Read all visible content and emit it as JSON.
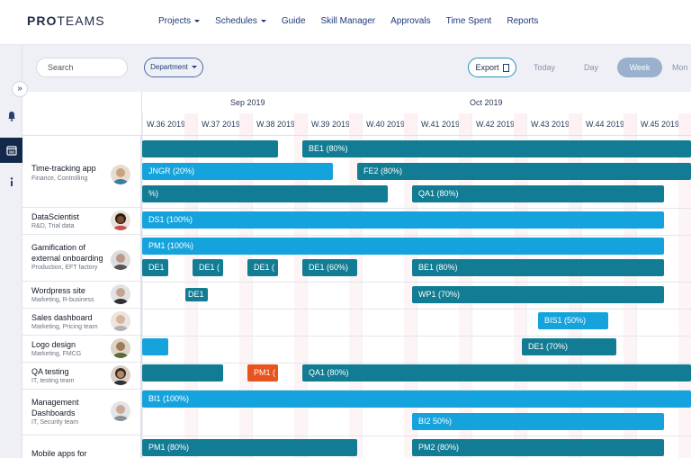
{
  "app": {
    "logo_bold": "PRO",
    "logo_rest": "TEAMS"
  },
  "nav": [
    {
      "label": "Projects",
      "dropdown": true
    },
    {
      "label": "Schedules",
      "dropdown": true
    },
    {
      "label": "Guide"
    },
    {
      "label": "Skill Manager"
    },
    {
      "label": "Approvals"
    },
    {
      "label": "Time Spent"
    },
    {
      "label": "Reports"
    }
  ],
  "toolbar": {
    "search_placeholder": "Search",
    "department_label": "Department",
    "export_label": "Export",
    "views": [
      "Today",
      "Day",
      "Week",
      "Mon"
    ],
    "active_view": "Week"
  },
  "rail": {
    "icons": [
      "expand-icon",
      "bell-icon",
      "calendar-icon",
      "info-icon"
    ],
    "active": "calendar-icon"
  },
  "timeline": {
    "months": [
      {
        "label": "Sep 2019"
      },
      {
        "label": "Oct 2019"
      }
    ],
    "weeks": [
      "W.36 2019",
      "W.37 2019",
      "W.38 2019",
      "W.39 2019",
      "W.40 2019",
      "W.41 2019",
      "W.42 2019",
      "W.43 2019",
      "W.44 2019",
      "W.45 2019"
    ]
  },
  "colors": {
    "dark_bar": "#117c93",
    "light_bar": "#15a3dd",
    "red_bar": "#e8531f",
    "active_rail": "#13294b"
  },
  "projects": [
    {
      "title": [
        "Time-tracking app"
      ],
      "sub": "Finance, Controlling",
      "avatar_color": "#c9a27e"
    },
    {
      "title": [
        "DataScientist"
      ],
      "sub": "R&D, Trial data",
      "avatar_color": "#5a3a2a"
    },
    {
      "title": [
        "Gamification of",
        "external onboarding"
      ],
      "sub": "Production, EFT factory",
      "avatar_color": "#8b7f75"
    },
    {
      "title": [
        "Wordpress site"
      ],
      "sub": "Marketing, R-business",
      "avatar_color": "#7d7d82"
    },
    {
      "title": [
        "Sales dashboard"
      ],
      "sub": "Marketing, Pricing team",
      "avatar_color": "#b89a86"
    },
    {
      "title": [
        "Logo design"
      ],
      "sub": "Marketing, FMCG",
      "avatar_color": "#6a5a46"
    },
    {
      "title": [
        "QA testing"
      ],
      "sub": "IT, testing team",
      "avatar_color": "#4a3a30"
    },
    {
      "title": [
        "Management",
        "Dashboards"
      ],
      "sub": "IT, Security team",
      "avatar_color": "#9a9aa0"
    },
    {
      "title": [
        "Mobile apps for"
      ],
      "sub": "",
      "avatar_color": ""
    }
  ],
  "bars": [
    {
      "label": "",
      "color": "dark"
    },
    {
      "label": "BE1 (80%)",
      "color": "dark"
    },
    {
      "label": "JNGR (20%)",
      "color": "light"
    },
    {
      "label": "FE2  (80%)",
      "color": "dark"
    },
    {
      "label": "%)",
      "color": "dark"
    },
    {
      "label": "QA1  (80%)",
      "color": "dark"
    },
    {
      "label": "DS1 (100%)",
      "color": "light"
    },
    {
      "label": "PM1 (100%)",
      "color": "light"
    },
    {
      "label": "DE1",
      "color": "dark"
    },
    {
      "label": "DE1  (",
      "color": "dark"
    },
    {
      "label": "DE1  (",
      "color": "dark"
    },
    {
      "label": "DE1  (60%)",
      "color": "dark"
    },
    {
      "label": "BE1  (80%)",
      "color": "dark"
    },
    {
      "label": "DE1",
      "color": "dark"
    },
    {
      "label": "WP1 (70%)",
      "color": "dark"
    },
    {
      "label": "BIS1   (50%)",
      "color": "light"
    },
    {
      "label": "",
      "color": "light"
    },
    {
      "label": "DE1   (70%)",
      "color": "dark"
    },
    {
      "label": "",
      "color": "dark"
    },
    {
      "label": "PM1  (",
      "color": "red"
    },
    {
      "label": "QA1  (80%)",
      "color": "dark"
    },
    {
      "label": "BI1 (100%)",
      "color": "light"
    },
    {
      "label": "BI2   50%)",
      "color": "light"
    },
    {
      "label": "PM1 (80%)",
      "color": "dark"
    },
    {
      "label": "PM2  (80%)",
      "color": "dark"
    }
  ]
}
